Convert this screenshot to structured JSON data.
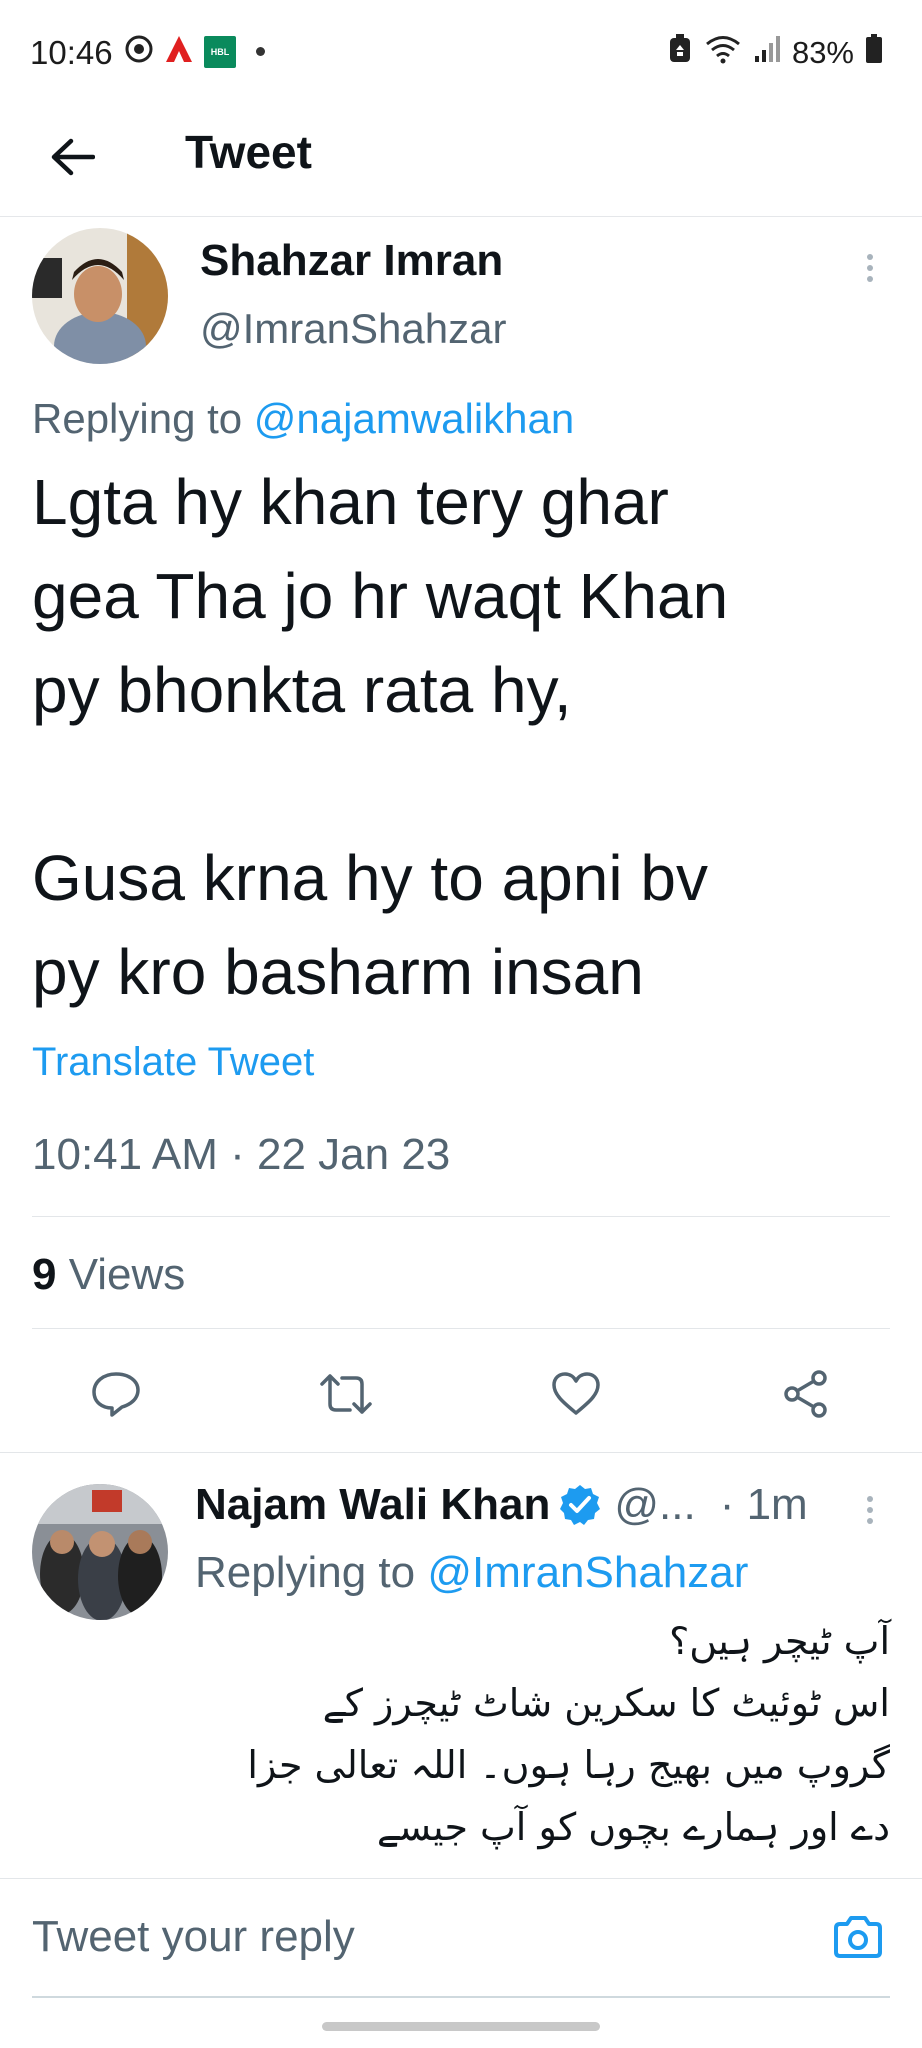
{
  "status_bar": {
    "time": "10:46",
    "hbl_label": "HBL",
    "battery": "83%"
  },
  "header": {
    "title": "Tweet"
  },
  "tweet": {
    "author_name": "Shahzar Imran",
    "author_handle": "@ImranShahzar",
    "replying_prefix": "Replying to",
    "replying_to": "@najamwalikhan",
    "text": "Lgta hy khan tery ghar\ngea Tha jo hr waqt Khan\npy bhonkta rata hy,\n\nGusa krna hy to apni bv\npy kro basharm insan",
    "translate_label": "Translate Tweet",
    "timestamp": "10:41 AM · 22 Jan 23",
    "views_count": "9",
    "views_label": "Views"
  },
  "actions": {
    "icons": [
      "reply-icon",
      "retweet-icon",
      "like-icon",
      "share-icon"
    ]
  },
  "reply": {
    "author_name": "Najam Wali Khan",
    "author_handle": "@...",
    "time": "· 1m",
    "replying_prefix": "Replying to",
    "replying_to": "@ImranShahzar",
    "text": "آپ ٹیچر ہیں؟\nاس ٹوئیٹ کا سکرین شاٹ ٹیچرز کے\nگروپ میں بھیج رہا ہوں۔ اللہ تعالی جزا\nدے اور ہمارے بچوں کو آپ جیسے"
  },
  "composer": {
    "placeholder": "Tweet your reply"
  },
  "colors": {
    "link": "#1d9bf0",
    "secondary_text": "#536471",
    "verified": "#1d9bf0"
  }
}
